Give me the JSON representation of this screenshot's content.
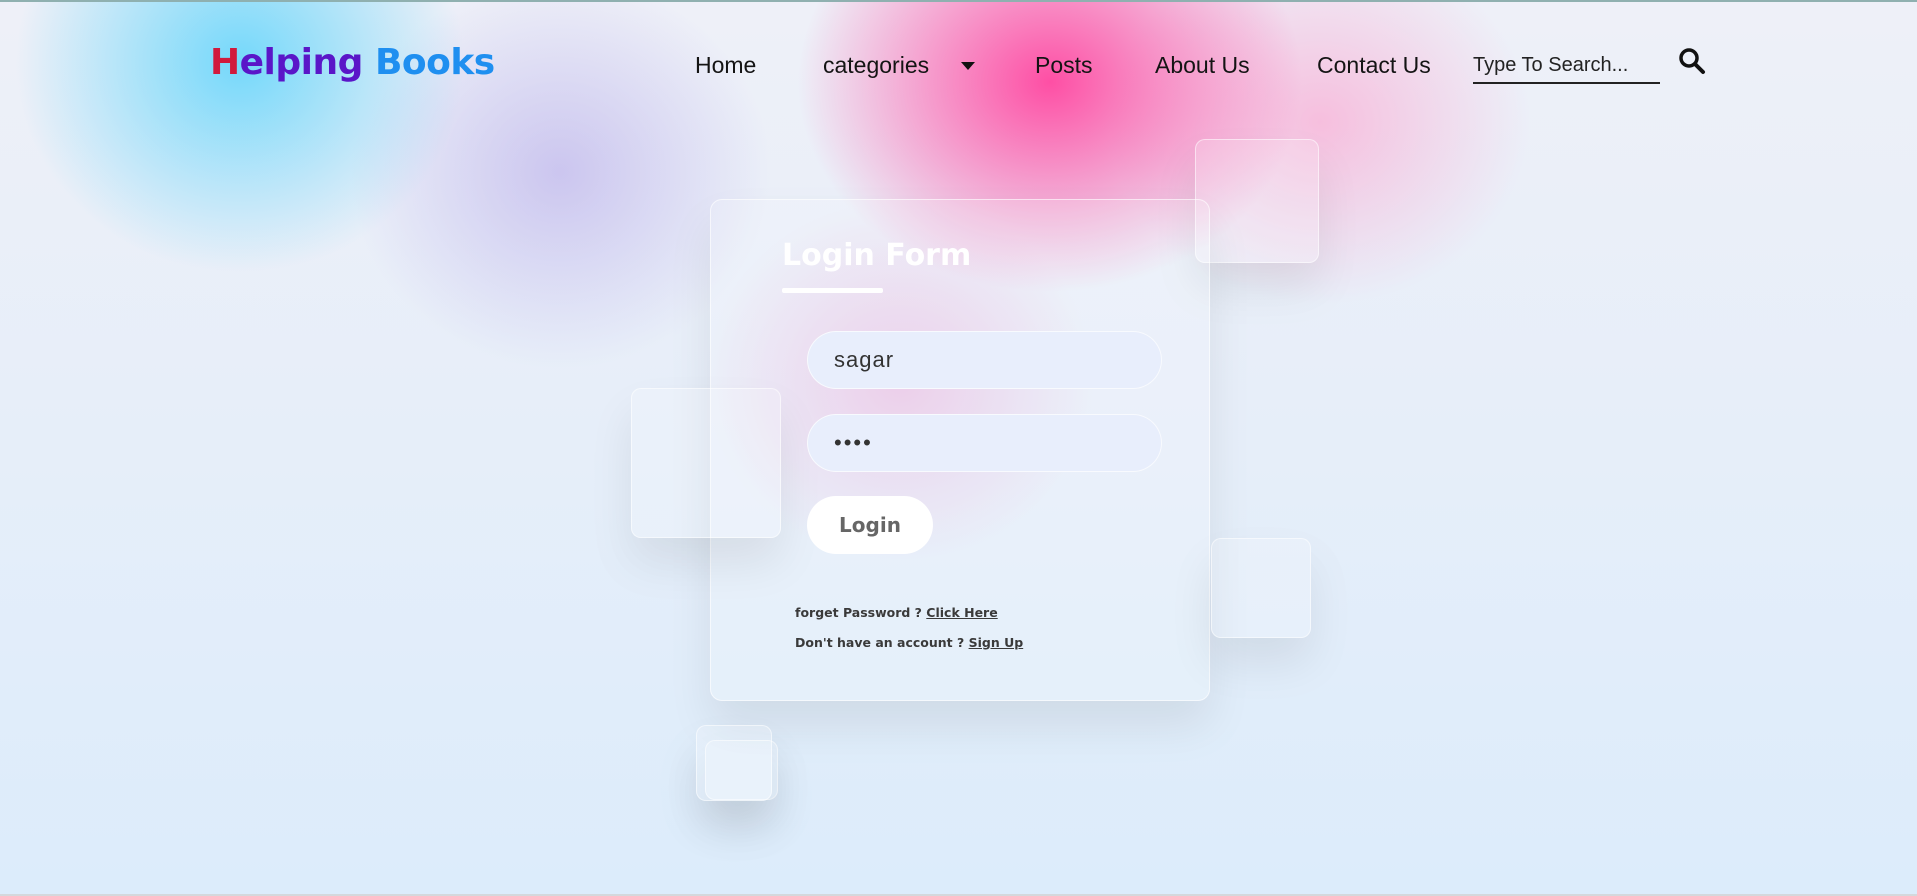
{
  "header": {
    "logo_h": "H",
    "logo_elping": "elping",
    "logo_books": "Books",
    "nav": {
      "home": "Home",
      "categories": "categories",
      "posts": "Posts",
      "about": "About Us",
      "contact": "Contact Us"
    },
    "search": {
      "placeholder": "Type To Search...",
      "icon": "search-icon"
    },
    "caret_icon": "caret-down-icon"
  },
  "login": {
    "title": "Login Form",
    "username_value": "sagar",
    "password_value": "1234",
    "submit_label": "Login",
    "forget_text": "forget Password ?",
    "forget_link": "Click Here",
    "signup_text": "Don't have an account ?",
    "signup_link": "Sign Up"
  },
  "colors": {
    "logo_h": "#d11a3c",
    "logo_elping": "#5a16c8",
    "logo_books": "#1f8ff0",
    "accent_pink": "#ff46a0",
    "accent_cyan": "#6ed7fa"
  }
}
